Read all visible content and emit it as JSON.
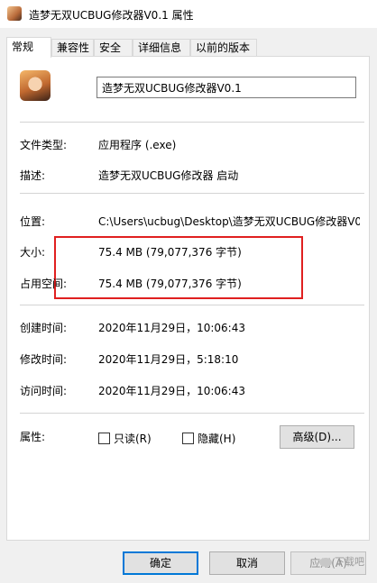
{
  "window": {
    "title": "造梦无双UCBUG修改器V0.1 属性",
    "icon": "app-icon"
  },
  "tabs": [
    {
      "label": "常规",
      "active": true
    },
    {
      "label": "兼容性",
      "active": false
    },
    {
      "label": "安全",
      "active": false
    },
    {
      "label": "详细信息",
      "active": false
    },
    {
      "label": "以前的版本",
      "active": false
    }
  ],
  "general": {
    "file_name": "造梦无双UCBUG修改器V0.1",
    "file_type_label": "文件类型:",
    "file_type_value": "应用程序 (.exe)",
    "description_label": "描述:",
    "description_value": "造梦无双UCBUG修改器 启动",
    "location_label": "位置:",
    "location_value": "C:\\Users\\ucbug\\Desktop\\造梦无双UCBUG修改器V0",
    "size_label": "大小:",
    "size_value": "75.4 MB (79,077,376 字节)",
    "size_on_disk_label": "占用空间:",
    "size_on_disk_value": "75.4 MB (79,077,376 字节)",
    "created_label": "创建时间:",
    "created_value": "2020年11月29日，10:06:43",
    "modified_label": "修改时间:",
    "modified_value": "2020年11月29日，5:18:10",
    "accessed_label": "访问时间:",
    "accessed_value": "2020年11月29日，10:06:43",
    "attributes_label": "属性:",
    "readonly_label": "只读(R)",
    "readonly_checked": false,
    "hidden_label": "隐藏(H)",
    "hidden_checked": false,
    "advanced_button": "高级(D)..."
  },
  "buttons": {
    "ok": "确定",
    "cancel": "取消",
    "apply": "应用(A)"
  },
  "watermark": "下载吧",
  "colors": {
    "highlight_box": "#e02020",
    "default_button_border": "#0078d7"
  }
}
